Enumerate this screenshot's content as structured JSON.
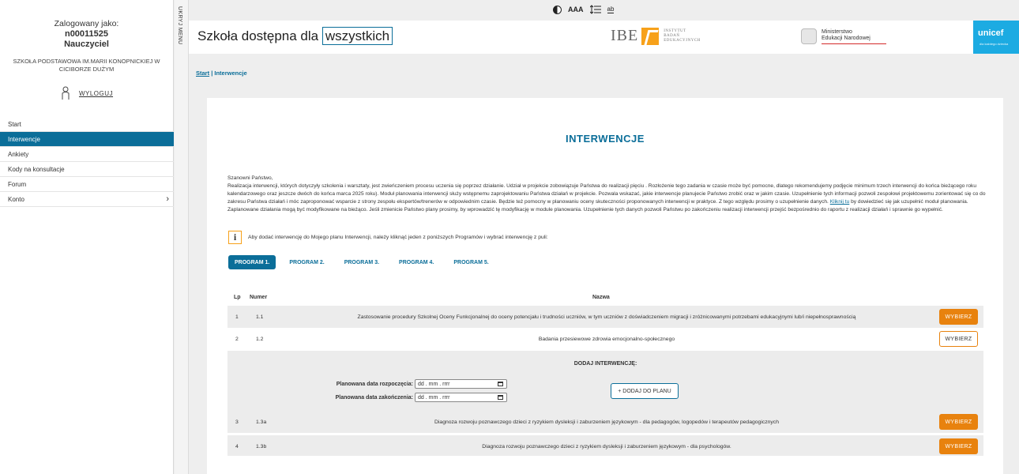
{
  "sidebar": {
    "logged_as_label": "Zalogowany jako:",
    "user_id": "n00011525",
    "role": "Nauczyciel",
    "school": "SZKOŁA PODSTAWOWA IM.MARII KONOPNICKIEJ W CICIBORZE DUŻYM",
    "logout_label": "WYLOGUJ",
    "menu": [
      {
        "label": "Start"
      },
      {
        "label": "Interwencje"
      },
      {
        "label": "Ankiety"
      },
      {
        "label": "Kody na konsultacje"
      },
      {
        "label": "Forum"
      },
      {
        "label": "Konto"
      }
    ],
    "hide_menu_label": "UKRYJ MENU"
  },
  "toolbar": {
    "font_size_label": "AAA",
    "spacing_label": "ab"
  },
  "header": {
    "brand_prefix": "Szkoła dostępna dla",
    "brand_highlight": "wszystkich",
    "ibe_text": "IBE",
    "ibe_sub": "INSTYTUT BADAŃ EDUKACYJNYCH",
    "ministry_line1": "Ministerstwo",
    "ministry_line2": "Edukacji Narodowej",
    "unicef_text": "unicef",
    "unicef_sub": "dla każdego dziecka"
  },
  "breadcrumb": {
    "start": "Start",
    "separator": "|",
    "current": "Interwencje"
  },
  "main": {
    "title": "INTERWENCJE",
    "greeting": "Szanowni Państwo,",
    "intro_part1": "Realizacja interwencji, których dotyczyły szkolenia i warsztaty, jest zwieńczeniem procesu uczenia się poprzez działanie. Udział w projekcie zobowiązuje Państwa do realizacji pięciu . Rozłożenie tego zadania w czasie może być pomocne, dlatego rekomendujemy podjęcie minimum trzech interwencji do końca bieżącego roku kalendarzowego oraz jeszcze dwóch do końca marca 2025 roku). Moduł planowania interwencji służy wstępnemu zaprojektowaniu Państwa działań w projekcie. Pozwala wskazać, jakie interwencje planujecie Państwo zrobić oraz w jakim czasie. Uzupełnienie tych informacji pozwoli zespołowi projektowemu zorientować się co do zakresu Państwa działań i móc zaproponować wsparcie z strony zespołu ekspertów/trenerów w odpowiednim czasie. Będzie też pomocny w planowaniu oceny skuteczności proponowanych interwencji w praktyce. Z tego względu prosimy o uzupełnienie danych.",
    "intro_link": "Kliknij tu",
    "intro_part2": "by dowiedzieć się jak uzupełnić moduł planowania. Zaplanowane działania mogą być modyfikowane na bieżąco. Jeśli zmienicie Państwo plany prosimy, by wprowadzić tę modyfikację w module planowania. Uzupełnienie tych danych pozwoli Państwu po zakończeniu realizacji interwencji przejść bezpośrednio do raportu z realizacji działań i sprawnie go wypełnić.",
    "info_icon": "i",
    "info_text": "Aby dodać interwencję do Mojego planu Interwencji, należy kliknąć jeden z poniższych Programów i wybrać interwencję z puli:",
    "tabs": [
      {
        "label": "PROGRAM 1."
      },
      {
        "label": "PROGRAM 2."
      },
      {
        "label": "PROGRAM 3."
      },
      {
        "label": "PROGRAM 4."
      },
      {
        "label": "PROGRAM 5."
      }
    ],
    "table": {
      "headers": {
        "lp": "Lp",
        "number": "Numer",
        "name": "Nazwa"
      },
      "rows": [
        {
          "lp": "1",
          "number": "1.1",
          "name": "Zastosowanie procedury Szkolnej Oceny Funkcjonalnej do oceny potencjału i trudności uczniów, w tym uczniów z doświadczeniem migracji i zróżnicowanymi potrzebami edukacyjnymi lub/i niepełnosprawnością",
          "button": "WYBIERZ"
        },
        {
          "lp": "2",
          "number": "1.2",
          "name": "Badania przesiewowe zdrowia emocjonalno-społecznego",
          "button": "WYBIERZ"
        },
        {
          "lp": "3",
          "number": "1.3a",
          "name": "Diagnoza rozwoju poznawczego dzieci z ryzykiem dysleksji i zaburzeniem językowym - dla pedagogów, logopedów i terapeutów pedagogicznych",
          "button": "WYBIERZ"
        },
        {
          "lp": "4",
          "number": "1.3b",
          "name": "Diagnoza rozwoju poznawczego dzieci z ryzykiem dysleksji i zaburzeniem językowym - dla psychologów.",
          "button": "WYBIERZ"
        }
      ]
    },
    "add_panel": {
      "title": "DODAJ INTERWENCJĘ:",
      "start_label": "Planowana data rozpoczęcia:",
      "start_value": "dd . mm . rrrr",
      "end_label": "Planowana data zakończenia:",
      "end_value": "dd . mm . rrrr",
      "add_button": "+ DODAJ DO PLANU"
    }
  },
  "colors": {
    "primary": "#0b6e99",
    "accent": "#e8820e",
    "unicef": "#1cabe2"
  }
}
